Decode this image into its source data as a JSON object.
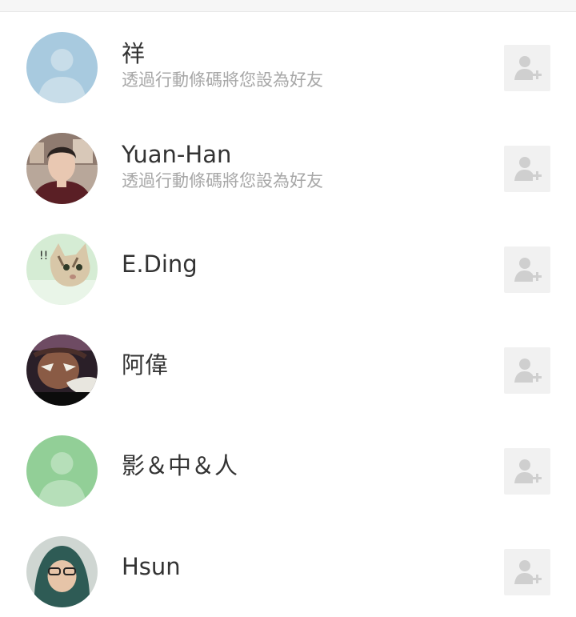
{
  "contacts": [
    {
      "name": "祥",
      "subtitle": "透過行動條碼將您設為好友",
      "avatar": "default-avatar-blue",
      "avatar_color": "#a8cadf"
    },
    {
      "name": "Yuan-Han",
      "subtitle": "透過行動條碼將您設為好友",
      "avatar": "photo-avatar-person",
      "avatar_color": "#5a3a32"
    },
    {
      "name": "E.Ding",
      "subtitle": "",
      "avatar": "photo-avatar-cat",
      "avatar_color": "#cfe9cf"
    },
    {
      "name": "阿偉",
      "subtitle": "",
      "avatar": "photo-avatar-anime",
      "avatar_color": "#3c2a34"
    },
    {
      "name": "影＆中＆人",
      "subtitle": "",
      "avatar": "default-avatar-green",
      "avatar_color": "#92cf97"
    },
    {
      "name": "Hsun",
      "subtitle": "",
      "avatar": "photo-avatar-hood",
      "avatar_color": "#2e5b55"
    }
  ],
  "add_friend_icon": "add-friend-icon",
  "colors": {
    "name_text": "#333333",
    "subtitle_text": "#a7a7a7",
    "add_button_bg": "#f1f1f1",
    "add_icon": "#cfcfcf"
  }
}
